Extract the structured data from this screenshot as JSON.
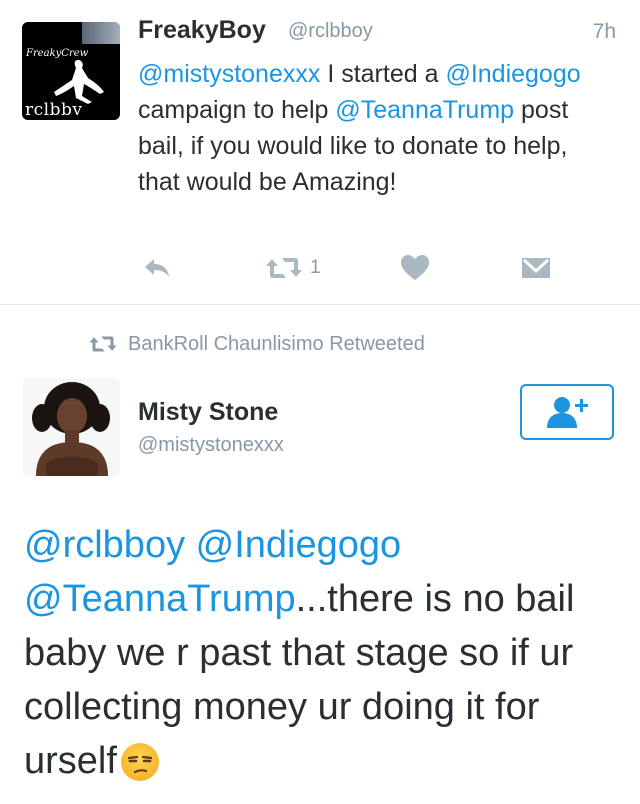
{
  "tweet1": {
    "name": "FreakyBoy",
    "handle": "@rclbboy",
    "time": "7h",
    "avatar_text_top": "FreakyCrew",
    "avatar_text_bottom": "rclbbv",
    "text_parts": [
      {
        "type": "mention",
        "text": "@mistystonexxx"
      },
      {
        "type": "text",
        "text": " I started a "
      },
      {
        "type": "mention",
        "text": "@Indiegogo"
      },
      {
        "type": "text",
        "text": " campaign to help "
      },
      {
        "type": "mention",
        "text": "@TeannaTrump"
      },
      {
        "type": "text",
        "text": " post bail, if you would like to donate to help, that would be Amazing!"
      }
    ],
    "retweet_count": "1",
    "icons": [
      "reply-icon",
      "retweet-icon",
      "like-heart-icon",
      "direct-message-icon"
    ]
  },
  "retweet_banner": {
    "label": "BankRoll Chaunlisimo Retweeted",
    "icon": "retweet-icon"
  },
  "tweet2": {
    "name": "Misty Stone",
    "handle": "@mistystonexxx",
    "follow_icon": "follow-user-plus-icon",
    "text_parts": [
      {
        "type": "mention",
        "text": "@rclbboy"
      },
      {
        "type": "text",
        "text": " "
      },
      {
        "type": "mention",
        "text": "@Indiegogo"
      },
      {
        "type": "text",
        "text": " "
      },
      {
        "type": "mention",
        "text": "@TeannaTrump"
      },
      {
        "type": "text",
        "text": "...there is no bail baby we r past that stage so if ur collecting money ur doing it for urself"
      }
    ],
    "emoji": "unamused-face-emoji"
  },
  "colors": {
    "accent": "#1b95e0",
    "text": "#292f33",
    "muted": "#8899a6",
    "divider": "#e1e8ed"
  }
}
